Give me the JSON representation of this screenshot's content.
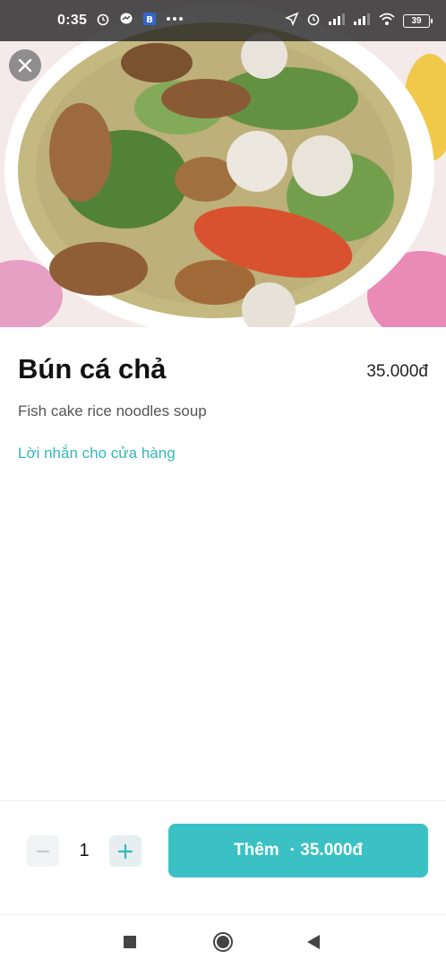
{
  "status_bar": {
    "time": "0:35",
    "battery": "39",
    "left_icons": [
      "alarm-icon",
      "messenger-icon",
      "app-icon",
      "more-icon"
    ],
    "right_icons": [
      "location-icon",
      "alarm-icon",
      "signal-icon",
      "signal-icon",
      "wifi-icon",
      "battery-icon"
    ]
  },
  "hero": {
    "image": "food-photo"
  },
  "product": {
    "name": "Bún cá chả",
    "price": "35.000đ",
    "description": "Fish cake rice noodles soup",
    "note_link": "Lời nhắn cho cửa hàng"
  },
  "order": {
    "quantity": "1",
    "add_label": "Thêm",
    "add_price": "· 35.000đ"
  },
  "colors": {
    "accent": "#3bc1c3",
    "link": "#34b7b9"
  },
  "nav": {
    "icons": [
      "recent-apps-icon",
      "home-icon",
      "back-icon"
    ]
  }
}
